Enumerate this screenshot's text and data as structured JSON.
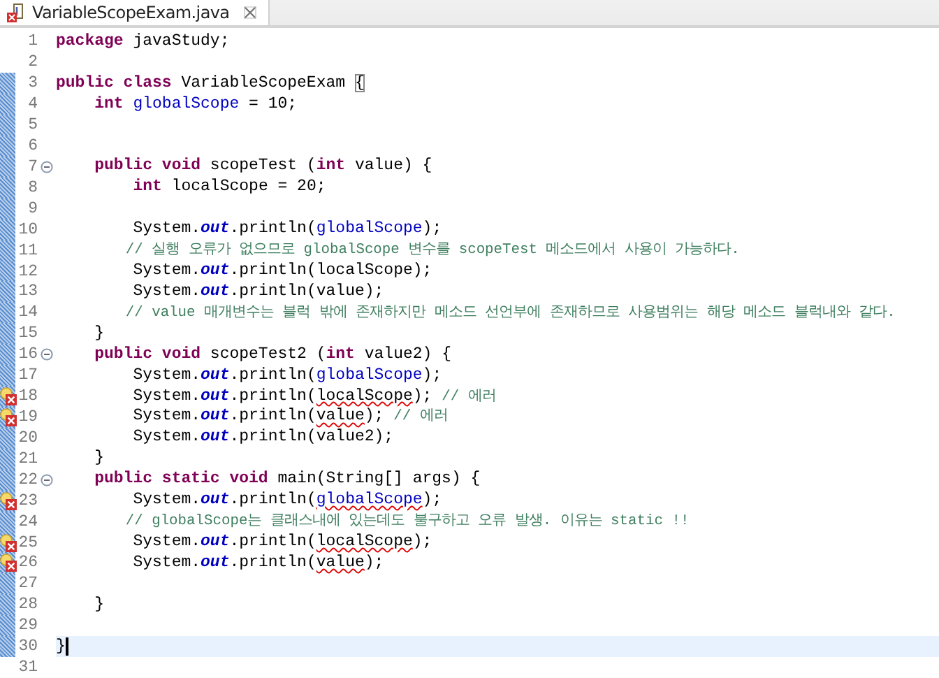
{
  "tabs": [
    {
      "title": "VariableScopeExam.java",
      "selected": true,
      "error": true
    }
  ],
  "lines": [
    {
      "number": "1",
      "fold": false,
      "error": false,
      "changed": false,
      "current": false,
      "tokens": [
        {
          "kind": "kw",
          "text": "package "
        },
        {
          "kind": "text",
          "text": "javaStudy;"
        }
      ]
    },
    {
      "number": "2",
      "fold": false,
      "error": false,
      "changed": false,
      "current": false
    },
    {
      "number": "3",
      "fold": false,
      "error": false,
      "changed": true,
      "current": false,
      "tokens": [
        {
          "kind": "kw",
          "text": "public class "
        },
        {
          "kind": "text",
          "text": "VariableScopeExam "
        },
        {
          "kind": "bracket",
          "text": "{"
        }
      ]
    },
    {
      "number": "4",
      "fold": false,
      "error": false,
      "changed": true,
      "current": false,
      "tokens": [
        {
          "kind": "kw",
          "text": "    int "
        },
        {
          "kind": "field",
          "text": "globalScope"
        },
        {
          "kind": "text",
          "text": " = 10;"
        }
      ]
    },
    {
      "number": "5",
      "fold": false,
      "error": false,
      "changed": true,
      "current": false
    },
    {
      "number": "6",
      "fold": false,
      "error": false,
      "changed": true,
      "current": false
    },
    {
      "number": "7",
      "fold": true,
      "error": false,
      "changed": true,
      "current": false,
      "tokens": [
        {
          "kind": "kw",
          "text": "    public void "
        },
        {
          "kind": "text",
          "text": "scopeTest ("
        },
        {
          "kind": "kw",
          "text": "int"
        },
        {
          "kind": "text",
          "text": " value) {"
        }
      ]
    },
    {
      "number": "8",
      "fold": false,
      "error": false,
      "changed": true,
      "current": false,
      "tokens": [
        {
          "kind": "kw",
          "text": "        int "
        },
        {
          "kind": "text",
          "text": "localScope = 20;"
        }
      ]
    },
    {
      "number": "9",
      "fold": false,
      "error": false,
      "changed": true,
      "current": false
    },
    {
      "number": "10",
      "fold": false,
      "error": false,
      "changed": true,
      "current": false,
      "tokens": [
        {
          "kind": "text",
          "text": "        System."
        },
        {
          "kind": "static",
          "text": "out"
        },
        {
          "kind": "text",
          "text": ".println("
        },
        {
          "kind": "field",
          "text": "globalScope"
        },
        {
          "kind": "text",
          "text": ");"
        }
      ]
    },
    {
      "number": "11",
      "fold": false,
      "error": false,
      "changed": true,
      "current": false,
      "tokens": [
        {
          "kind": "comment",
          "text": "        // 실행 오류가 없으므로 globalScope 변수를 scopeTest 메소드에서 사용이 가능하다."
        }
      ]
    },
    {
      "number": "12",
      "fold": false,
      "error": false,
      "changed": true,
      "current": false,
      "tokens": [
        {
          "kind": "text",
          "text": "        System."
        },
        {
          "kind": "static",
          "text": "out"
        },
        {
          "kind": "text",
          "text": ".println(localScope);"
        }
      ]
    },
    {
      "number": "13",
      "fold": false,
      "error": false,
      "changed": true,
      "current": false,
      "tokens": [
        {
          "kind": "text",
          "text": "        System."
        },
        {
          "kind": "static",
          "text": "out"
        },
        {
          "kind": "text",
          "text": ".println(value);"
        }
      ]
    },
    {
      "number": "14",
      "fold": false,
      "error": false,
      "changed": true,
      "current": false,
      "tokens": [
        {
          "kind": "comment",
          "text": "        // value 매개변수는 블럭 밖에 존재하지만 메소드 선언부에 존재하므로 사용범위는 해당 메소드 블럭내와 같다."
        }
      ]
    },
    {
      "number": "15",
      "fold": false,
      "error": false,
      "changed": true,
      "current": false,
      "tokens": [
        {
          "kind": "text",
          "text": "    }"
        }
      ]
    },
    {
      "number": "16",
      "fold": true,
      "error": false,
      "changed": true,
      "current": false,
      "tokens": [
        {
          "kind": "kw",
          "text": "    public void "
        },
        {
          "kind": "text",
          "text": "scopeTest2 ("
        },
        {
          "kind": "kw",
          "text": "int"
        },
        {
          "kind": "text",
          "text": " value2) {"
        }
      ]
    },
    {
      "number": "17",
      "fold": false,
      "error": false,
      "changed": true,
      "current": false,
      "tokens": [
        {
          "kind": "text",
          "text": "        System."
        },
        {
          "kind": "static",
          "text": "out"
        },
        {
          "kind": "text",
          "text": ".println("
        },
        {
          "kind": "field",
          "text": "globalScope"
        },
        {
          "kind": "text",
          "text": ");"
        }
      ]
    },
    {
      "number": "18",
      "fold": false,
      "error": true,
      "changed": true,
      "current": false,
      "tokens": [
        {
          "kind": "text",
          "text": "        System."
        },
        {
          "kind": "static",
          "text": "out"
        },
        {
          "kind": "text",
          "text": ".println("
        },
        {
          "kind": "error",
          "text": "localScope"
        },
        {
          "kind": "text",
          "text": "); "
        },
        {
          "kind": "comment",
          "text": "// 에러"
        }
      ]
    },
    {
      "number": "19",
      "fold": false,
      "error": true,
      "changed": true,
      "current": false,
      "tokens": [
        {
          "kind": "text",
          "text": "        System."
        },
        {
          "kind": "static",
          "text": "out"
        },
        {
          "kind": "text",
          "text": ".println("
        },
        {
          "kind": "error",
          "text": "value"
        },
        {
          "kind": "text",
          "text": "); "
        },
        {
          "kind": "comment",
          "text": "// 에러"
        }
      ]
    },
    {
      "number": "20",
      "fold": false,
      "error": false,
      "changed": true,
      "current": false,
      "tokens": [
        {
          "kind": "text",
          "text": "        System."
        },
        {
          "kind": "static",
          "text": "out"
        },
        {
          "kind": "text",
          "text": ".println(value2);"
        }
      ]
    },
    {
      "number": "21",
      "fold": false,
      "error": false,
      "changed": true,
      "current": false,
      "tokens": [
        {
          "kind": "text",
          "text": "    }"
        }
      ]
    },
    {
      "number": "22",
      "fold": true,
      "error": false,
      "changed": true,
      "current": false,
      "tokens": [
        {
          "kind": "kw",
          "text": "    public static void "
        },
        {
          "kind": "text",
          "text": "main(String[] args) {"
        }
      ]
    },
    {
      "number": "23",
      "fold": false,
      "error": true,
      "changed": true,
      "current": false,
      "tokens": [
        {
          "kind": "text",
          "text": "        System."
        },
        {
          "kind": "static",
          "text": "out"
        },
        {
          "kind": "text",
          "text": ".println("
        },
        {
          "kind": "field_error",
          "text": "globalScope"
        },
        {
          "kind": "text",
          "text": ");"
        }
      ]
    },
    {
      "number": "24",
      "fold": false,
      "error": false,
      "changed": true,
      "current": false,
      "tokens": [
        {
          "kind": "comment",
          "text": "        // globalScope는 클래스내에 있는데도 불구하고 오류 발생. 이유는 static !!"
        }
      ]
    },
    {
      "number": "25",
      "fold": false,
      "error": true,
      "changed": true,
      "current": false,
      "tokens": [
        {
          "kind": "text",
          "text": "        System."
        },
        {
          "kind": "static",
          "text": "out"
        },
        {
          "kind": "text",
          "text": ".println("
        },
        {
          "kind": "error",
          "text": "localScope"
        },
        {
          "kind": "text",
          "text": ");"
        }
      ]
    },
    {
      "number": "26",
      "fold": false,
      "error": true,
      "changed": true,
      "current": false,
      "tokens": [
        {
          "kind": "text",
          "text": "        System."
        },
        {
          "kind": "static",
          "text": "out"
        },
        {
          "kind": "text",
          "text": ".println("
        },
        {
          "kind": "error",
          "text": "value"
        },
        {
          "kind": "text",
          "text": ");"
        }
      ]
    },
    {
      "number": "27",
      "fold": false,
      "error": false,
      "changed": true,
      "current": false
    },
    {
      "number": "28",
      "fold": false,
      "error": false,
      "changed": true,
      "current": false,
      "tokens": [
        {
          "kind": "text",
          "text": "    }"
        }
      ]
    },
    {
      "number": "29",
      "fold": false,
      "error": false,
      "changed": true,
      "current": false
    },
    {
      "number": "30",
      "fold": false,
      "error": false,
      "changed": true,
      "current": true,
      "tokens": [
        {
          "kind": "text",
          "text": "}"
        }
      ]
    },
    {
      "number": "31",
      "fold": false,
      "error": false,
      "changed": false,
      "current": false
    }
  ]
}
